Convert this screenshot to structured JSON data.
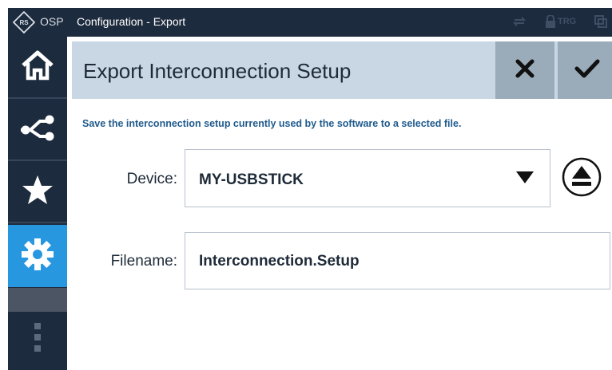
{
  "topbar": {
    "logo_text": "OSP",
    "title": "Configuration - Export",
    "status_trg": "TRG",
    "icons": [
      "rs-logo-icon",
      "sync-icon",
      "lock-icon",
      "window-icon"
    ]
  },
  "sidebar": {
    "items": [
      {
        "name": "home",
        "icon": "home-icon",
        "active": false
      },
      {
        "name": "interconnection",
        "icon": "connection-icon",
        "active": false
      },
      {
        "name": "favorites",
        "icon": "star-icon",
        "active": false
      },
      {
        "name": "configuration",
        "icon": "gear-icon",
        "active": true
      },
      {
        "name": "more",
        "icon": "vertical-dots-icon",
        "active": false
      }
    ]
  },
  "dialog": {
    "title": "Export Interconnection Setup",
    "description": "Save the interconnection setup currently used by the software to a selected file.",
    "device": {
      "label": "Device:",
      "value": "MY-USBSTICK"
    },
    "filename": {
      "label": "Filename:",
      "value": "Interconnection.Setup"
    }
  },
  "colors": {
    "topbar_bg": "#1d2b3e",
    "sidebar_bg": "#1d2b3e",
    "active_item": "#2797e0",
    "header_bg": "#c8d7e3",
    "header_button_bg": "#9aabba",
    "description_text": "#1f5a8c"
  }
}
